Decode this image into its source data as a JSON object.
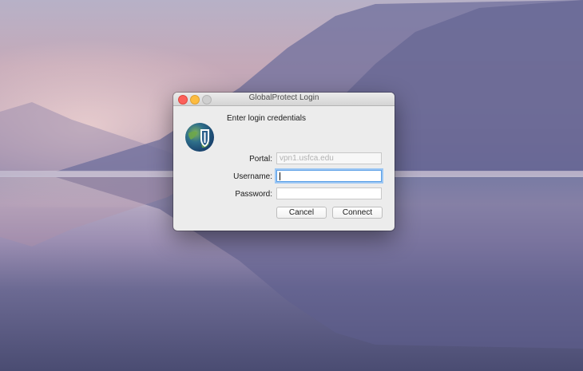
{
  "window": {
    "title": "GlobalProtect Login"
  },
  "dialog": {
    "heading": "Enter login credentials",
    "portal": {
      "label": "Portal:",
      "value": "vpn1.usfca.edu"
    },
    "username": {
      "label": "Username:",
      "value": ""
    },
    "password": {
      "label": "Password:",
      "value": ""
    },
    "cancel_label": "Cancel",
    "connect_label": "Connect"
  },
  "colors": {
    "close": "#fc605b",
    "minimize": "#fdbc40",
    "focus_ring": "#5b9fe6"
  },
  "icons": [
    "globalprotect-logo-icon"
  ]
}
